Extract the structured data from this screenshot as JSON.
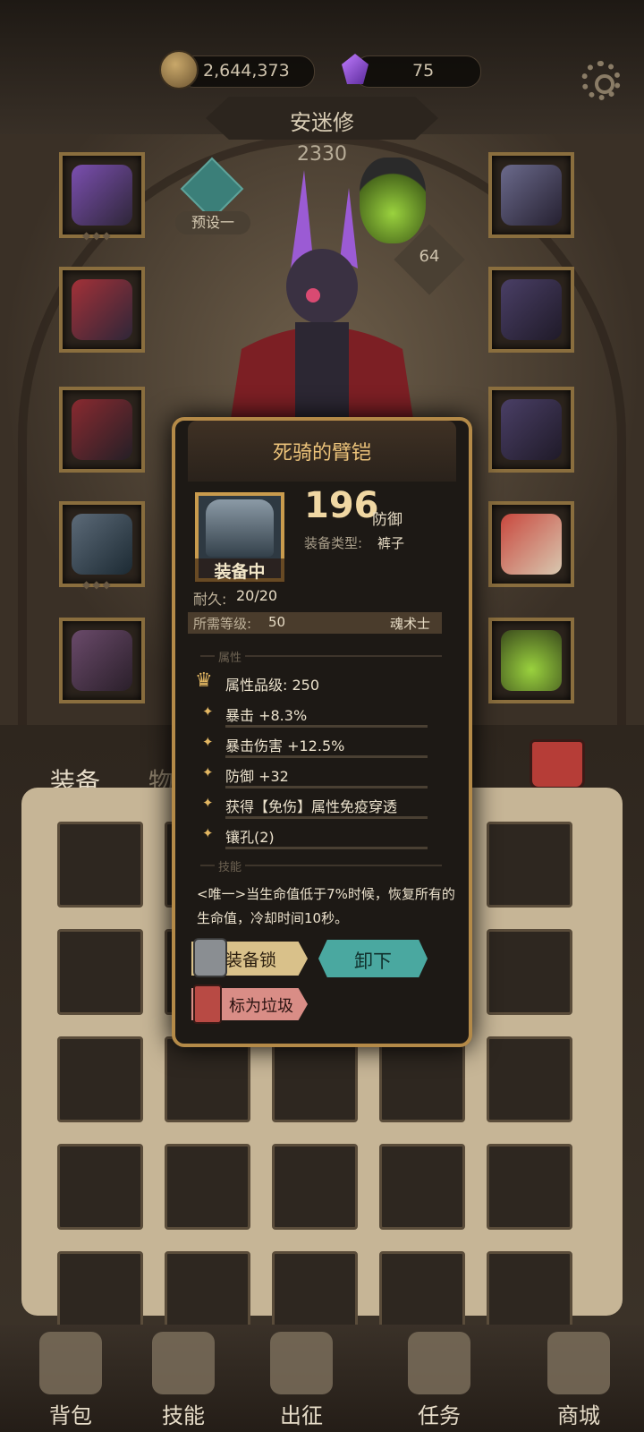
{
  "currency": {
    "gold": "2,644,373",
    "gems": "75"
  },
  "hero": {
    "name": "安迷修",
    "power": "2330"
  },
  "preset_label": "预设一",
  "pet_level": "64",
  "bag_tabs": {
    "equipment": "装备",
    "items": "物品"
  },
  "nav": [
    {
      "label": "背包",
      "icon": "backpack-icon"
    },
    {
      "label": "技能",
      "icon": "skill-book-icon"
    },
    {
      "label": "出征",
      "icon": "sword-map-icon"
    },
    {
      "label": "任务",
      "icon": "scroll-icon"
    },
    {
      "label": "商城",
      "icon": "shop-icon"
    }
  ],
  "item": {
    "name": "死骑的臂铠",
    "equipped_badge": "装备中",
    "defense_value": "196",
    "defense_label": "防御",
    "type_label": "装备类型:",
    "type_value": "裤子",
    "durability_label": "耐久:",
    "durability_value": "20/20",
    "required_level_label": "所需等级:",
    "required_level": "50",
    "required_class": "魂术士",
    "attributes_section": "属性",
    "attribute_quality": "属性品级: 250",
    "attributes": [
      "暴击 +8.3%",
      "暴击伤害 +12.5%",
      "防御 +32",
      "获得【免伤】属性免疫穿透",
      "镶孔(2)"
    ],
    "skill_section": "技能",
    "skill_text": "<唯一>当生命值低于7%时候，恢复所有的生命值，冷却时间10秒。",
    "buttons": {
      "lock": "装备锁",
      "unequip": "卸下",
      "junk": "标为垃圾"
    }
  },
  "colors": {
    "accent_gold": "#c99b4d",
    "teal_button": "#4aa8a0",
    "lock_button": "#d9c18a",
    "junk_button": "#d98d86"
  }
}
